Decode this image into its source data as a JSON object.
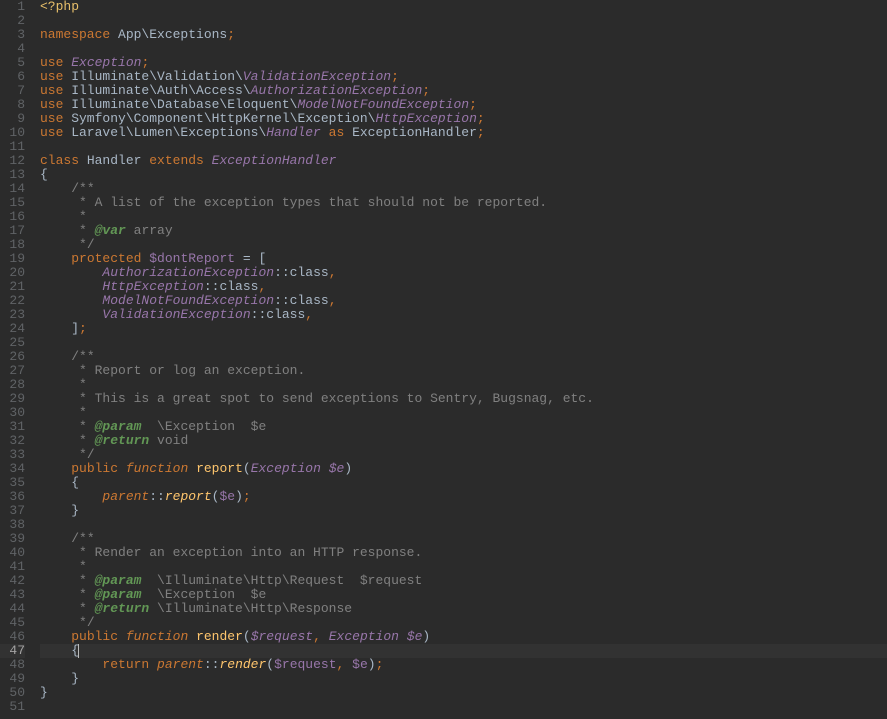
{
  "lines": [
    [
      [
        "tag",
        "<?php"
      ]
    ],
    [],
    [
      [
        "kw",
        "namespace"
      ],
      [
        "ns",
        " App\\Exceptions"
      ],
      [
        "punct",
        ";"
      ]
    ],
    [],
    [
      [
        "kw",
        "use"
      ],
      [
        "ns",
        " "
      ],
      [
        "cls-i",
        "Exception"
      ],
      [
        "punct",
        ";"
      ]
    ],
    [
      [
        "kw",
        "use"
      ],
      [
        "ns",
        " Illuminate\\Validation\\"
      ],
      [
        "cls-i",
        "ValidationException"
      ],
      [
        "punct",
        ";"
      ]
    ],
    [
      [
        "kw",
        "use"
      ],
      [
        "ns",
        " Illuminate\\Auth\\Access\\"
      ],
      [
        "cls-i",
        "AuthorizationException"
      ],
      [
        "punct",
        ";"
      ]
    ],
    [
      [
        "kw",
        "use"
      ],
      [
        "ns",
        " Illuminate\\Database\\Eloquent\\"
      ],
      [
        "cls-i",
        "ModelNotFoundException"
      ],
      [
        "punct",
        ";"
      ]
    ],
    [
      [
        "kw",
        "use"
      ],
      [
        "ns",
        " Symfony\\Component\\HttpKernel\\Exception\\"
      ],
      [
        "cls-i",
        "HttpException"
      ],
      [
        "punct",
        ";"
      ]
    ],
    [
      [
        "kw",
        "use"
      ],
      [
        "ns",
        " Laravel\\Lumen\\Exceptions\\"
      ],
      [
        "cls-i",
        "Handler"
      ],
      [
        "ns",
        " "
      ],
      [
        "kw",
        "as"
      ],
      [
        "ns",
        " ExceptionHandler"
      ],
      [
        "punct",
        ";"
      ]
    ],
    [],
    [
      [
        "kw",
        "class"
      ],
      [
        "classdef",
        " Handler "
      ],
      [
        "kw",
        "extends"
      ],
      [
        "ns",
        " "
      ],
      [
        "cls-i",
        "ExceptionHandler"
      ]
    ],
    [
      [
        "brace",
        "{"
      ]
    ],
    [
      [
        "ns",
        "    "
      ],
      [
        "comment",
        "/**"
      ]
    ],
    [
      [
        "ns",
        "    "
      ],
      [
        "comment",
        " * A list of the exception types that should not be reported."
      ]
    ],
    [
      [
        "ns",
        "    "
      ],
      [
        "comment",
        " *"
      ]
    ],
    [
      [
        "ns",
        "    "
      ],
      [
        "comment",
        " * "
      ],
      [
        "doctag",
        "@var"
      ],
      [
        "comment",
        " array"
      ]
    ],
    [
      [
        "ns",
        "    "
      ],
      [
        "comment",
        " */"
      ]
    ],
    [
      [
        "ns",
        "    "
      ],
      [
        "kw",
        "protected"
      ],
      [
        "ns",
        " "
      ],
      [
        "var",
        "$dontReport"
      ],
      [
        "ns",
        " "
      ],
      [
        "op",
        "="
      ],
      [
        "ns",
        " "
      ],
      [
        "brace",
        "["
      ]
    ],
    [
      [
        "ns",
        "        "
      ],
      [
        "cls-i",
        "AuthorizationException"
      ],
      [
        "ns",
        "::"
      ],
      [
        "ns",
        "class"
      ],
      [
        "punct",
        ","
      ]
    ],
    [
      [
        "ns",
        "        "
      ],
      [
        "cls-i",
        "HttpException"
      ],
      [
        "ns",
        "::"
      ],
      [
        "ns",
        "class"
      ],
      [
        "punct",
        ","
      ]
    ],
    [
      [
        "ns",
        "        "
      ],
      [
        "cls-i",
        "ModelNotFoundException"
      ],
      [
        "ns",
        "::"
      ],
      [
        "ns",
        "class"
      ],
      [
        "punct",
        ","
      ]
    ],
    [
      [
        "ns",
        "        "
      ],
      [
        "cls-i",
        "ValidationException"
      ],
      [
        "ns",
        "::"
      ],
      [
        "ns",
        "class"
      ],
      [
        "punct",
        ","
      ]
    ],
    [
      [
        "ns",
        "    "
      ],
      [
        "brace",
        "]"
      ],
      [
        "punct",
        ";"
      ]
    ],
    [],
    [
      [
        "ns",
        "    "
      ],
      [
        "comment",
        "/**"
      ]
    ],
    [
      [
        "ns",
        "    "
      ],
      [
        "comment",
        " * Report or log an exception."
      ]
    ],
    [
      [
        "ns",
        "    "
      ],
      [
        "comment",
        " *"
      ]
    ],
    [
      [
        "ns",
        "    "
      ],
      [
        "comment",
        " * This is a great spot to send exceptions to Sentry, Bugsnag, etc."
      ]
    ],
    [
      [
        "ns",
        "    "
      ],
      [
        "comment",
        " *"
      ]
    ],
    [
      [
        "ns",
        "    "
      ],
      [
        "comment",
        " * "
      ],
      [
        "doctag",
        "@param"
      ],
      [
        "comment",
        "  \\Exception  $e"
      ]
    ],
    [
      [
        "ns",
        "    "
      ],
      [
        "comment",
        " * "
      ],
      [
        "doctag",
        "@return"
      ],
      [
        "comment",
        " void"
      ]
    ],
    [
      [
        "ns",
        "    "
      ],
      [
        "comment",
        " */"
      ]
    ],
    [
      [
        "ns",
        "    "
      ],
      [
        "kw",
        "public"
      ],
      [
        "ns",
        " "
      ],
      [
        "kw ital",
        "function"
      ],
      [
        "ns",
        " "
      ],
      [
        "fn",
        "report"
      ],
      [
        "brace",
        "("
      ],
      [
        "cls-i",
        "Exception"
      ],
      [
        "ns",
        " "
      ],
      [
        "var ital",
        "$e"
      ],
      [
        "brace",
        ")"
      ]
    ],
    [
      [
        "ns",
        "    "
      ],
      [
        "brace",
        "{"
      ]
    ],
    [
      [
        "ns",
        "        "
      ],
      [
        "parent",
        "parent"
      ],
      [
        "ns",
        "::"
      ],
      [
        "fn ital",
        "report"
      ],
      [
        "brace",
        "("
      ],
      [
        "var",
        "$e"
      ],
      [
        "brace",
        ")"
      ],
      [
        "punct",
        ";"
      ]
    ],
    [
      [
        "ns",
        "    "
      ],
      [
        "brace",
        "}"
      ]
    ],
    [],
    [
      [
        "ns",
        "    "
      ],
      [
        "comment",
        "/**"
      ]
    ],
    [
      [
        "ns",
        "    "
      ],
      [
        "comment",
        " * Render an exception into an HTTP response."
      ]
    ],
    [
      [
        "ns",
        "    "
      ],
      [
        "comment",
        " *"
      ]
    ],
    [
      [
        "ns",
        "    "
      ],
      [
        "comment",
        " * "
      ],
      [
        "doctag",
        "@param"
      ],
      [
        "comment",
        "  \\Illuminate\\Http\\Request  $request"
      ]
    ],
    [
      [
        "ns",
        "    "
      ],
      [
        "comment",
        " * "
      ],
      [
        "doctag",
        "@param"
      ],
      [
        "comment",
        "  \\Exception  $e"
      ]
    ],
    [
      [
        "ns",
        "    "
      ],
      [
        "comment",
        " * "
      ],
      [
        "doctag",
        "@return"
      ],
      [
        "comment",
        " \\Illuminate\\Http\\Response"
      ]
    ],
    [
      [
        "ns",
        "    "
      ],
      [
        "comment",
        " */"
      ]
    ],
    [
      [
        "ns",
        "    "
      ],
      [
        "kw",
        "public"
      ],
      [
        "ns",
        " "
      ],
      [
        "kw ital",
        "function"
      ],
      [
        "ns",
        " "
      ],
      [
        "fn",
        "render"
      ],
      [
        "brace",
        "("
      ],
      [
        "var ital",
        "$request"
      ],
      [
        "punct",
        ","
      ],
      [
        "ns",
        " "
      ],
      [
        "cls-i",
        "Exception"
      ],
      [
        "ns",
        " "
      ],
      [
        "var ital",
        "$e"
      ],
      [
        "brace",
        ")"
      ]
    ],
    [
      [
        "ns",
        "    "
      ],
      [
        "brace",
        "{"
      ]
    ],
    [
      [
        "ns",
        "        "
      ],
      [
        "kw",
        "return"
      ],
      [
        "ns",
        " "
      ],
      [
        "parent",
        "parent"
      ],
      [
        "ns",
        "::"
      ],
      [
        "fn ital",
        "render"
      ],
      [
        "brace",
        "("
      ],
      [
        "var",
        "$request"
      ],
      [
        "punct",
        ","
      ],
      [
        "ns",
        " "
      ],
      [
        "var",
        "$e"
      ],
      [
        "brace",
        ")"
      ],
      [
        "punct",
        ";"
      ]
    ],
    [
      [
        "ns",
        "    "
      ],
      [
        "brace",
        "}"
      ]
    ],
    [
      [
        "brace",
        "}"
      ]
    ],
    []
  ],
  "currentLine": 47,
  "cursorAfterToken": 1
}
